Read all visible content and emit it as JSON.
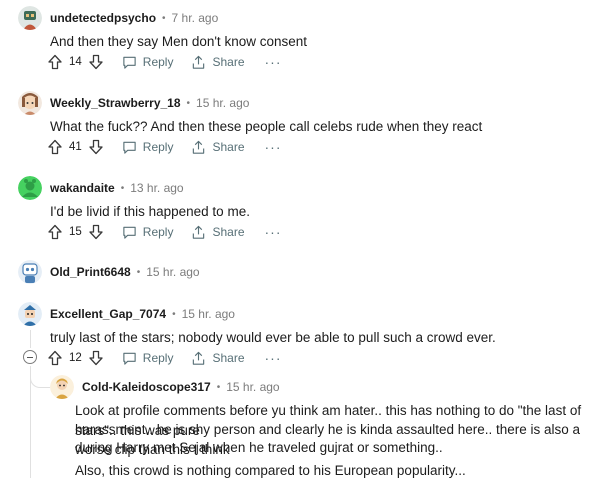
{
  "comments": [
    {
      "username": "undetectedpsycho",
      "time": "7 hr. ago",
      "text": "And then they say Men don't know consent",
      "votes": "14",
      "avatar": "avatar-character-icon",
      "avatar_color": "#3d6b55"
    },
    {
      "username": "Weekly_Strawberry_18",
      "time": "15 hr. ago",
      "text": "What the fuck?? And then these people call celebs rude when they react",
      "votes": "41",
      "avatar": "avatar-character-icon",
      "avatar_color": "#8a5a3c"
    },
    {
      "username": "wakandaite",
      "time": "13 hr. ago",
      "text": "I'd be livid if this happened to me.",
      "votes": "15",
      "avatar": "avatar-default-icon",
      "avatar_color": "#46d160"
    },
    {
      "username": "Old_Print6648",
      "time": "15 hr. ago",
      "avatar": "avatar-character-icon",
      "avatar_color": "#4a7fb5"
    },
    {
      "username": "Excellent_Gap_7074",
      "time": "15 hr. ago",
      "text": "truly last of the stars; nobody would ever be able to pull such a crowd ever.",
      "votes": "12",
      "avatar": "avatar-character-icon",
      "avatar_color": "#2f6fa8"
    },
    {
      "username": "Cold-Kaleidoscope317",
      "time": "15 hr. ago",
      "text_lines": [
        "Look at profile comments before yu think am hater.. this has nothing to do \"the last of stars\".. this was pure",
        "harassment.. he is shy person and clearly he is kinda assaulted here.. there is also a worse clip than this I think",
        "during Harry met Sejal when he traveled gujrat or something..",
        "Also, this crowd is nothing compared to his European popularity..."
      ],
      "avatar": "avatar-character-icon",
      "avatar_color": "#d9a441"
    }
  ],
  "actions": {
    "separator": "•",
    "reply_label": "Reply",
    "share_label": "Share",
    "more_label": "···"
  }
}
